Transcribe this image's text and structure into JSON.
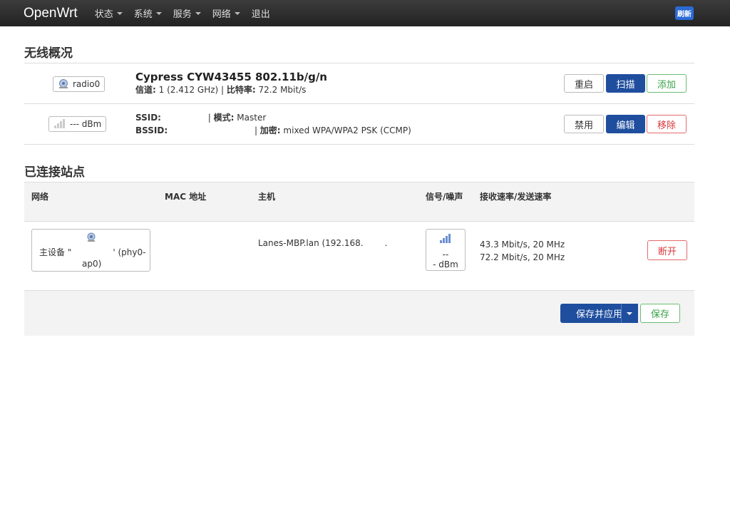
{
  "nav": {
    "brand": "OpenWrt",
    "menu": [
      {
        "label": "状态",
        "dropdown": true
      },
      {
        "label": "系统",
        "dropdown": true
      },
      {
        "label": "服务",
        "dropdown": true
      },
      {
        "label": "网络",
        "dropdown": true
      },
      {
        "label": "退出",
        "dropdown": false
      }
    ],
    "refresh": "刷新"
  },
  "wireless": {
    "title": "无线概况",
    "device": {
      "badge": "radio0",
      "name": "Cypress CYW43455 802.11b/g/n",
      "channel_label": "信道:",
      "channel_value": " 1 (2.412 GHz) | ",
      "bitrate_label": "比特率:",
      "bitrate_value": " 72.2 Mbit/s",
      "buttons": {
        "restart": "重启",
        "scan": "扫描",
        "add": "添加"
      }
    },
    "network": {
      "badge": "--- dBm",
      "ssid_label": "SSID:",
      "mode_sep": " | ",
      "mode_label": "模式:",
      "mode_value": " Master",
      "bssid_label": "BSSID:",
      "enc_sep": " | ",
      "enc_label": "加密:",
      "enc_value": " mixed WPA/WPA2 PSK (CCMP)",
      "buttons": {
        "disable": "禁用",
        "edit": "编辑",
        "remove": "移除"
      }
    }
  },
  "stations": {
    "title": "已连接站点",
    "headers": {
      "network": "网络",
      "mac": "MAC 地址",
      "host": "主机",
      "signal": "信号/噪声",
      "rate": "接收速率/发送速率"
    },
    "row": {
      "network_text": "主设备 \"",
      "network_suffix": "' (phy0-",
      "network_line2": "ap0)",
      "host": "Lanes-MBP.lan (192.168.",
      "host_tail": ".",
      "signal_line1": "--",
      "signal_line2": "- dBm",
      "rx": "43.3 Mbit/s, 20 MHz",
      "tx": "72.2 Mbit/s, 20 MHz",
      "disconnect": "断开"
    }
  },
  "footer": {
    "save_apply": "保存并应用",
    "save": "保存"
  },
  "colors": {
    "primary": "#1f4e9e",
    "green": "#3aa24a",
    "red": "#d9383a"
  }
}
